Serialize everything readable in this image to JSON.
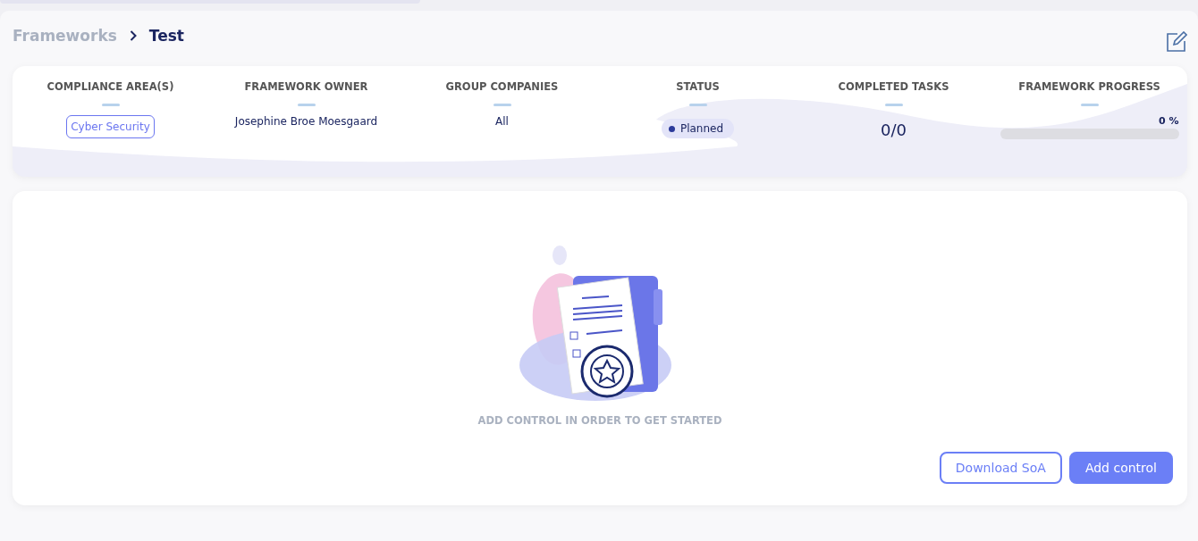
{
  "breadcrumb": [
    {
      "label": "Frameworks",
      "selected": false
    },
    {
      "label": "Test",
      "selected": true
    }
  ],
  "summary": [
    {
      "kind": "tag",
      "heading": "COMPLIANCE AREA(S)",
      "value": "Cyber Security"
    },
    {
      "kind": "text",
      "heading": "FRAMEWORK OWNER",
      "value": "Josephine Broe Moesgaard"
    },
    {
      "kind": "text",
      "heading": "GROUP COMPANIES",
      "value": "All"
    },
    {
      "kind": "status",
      "heading": "STATUS",
      "value": "Planned",
      "color": "#2b3a9a"
    },
    {
      "kind": "count",
      "heading": "COMPLETED TASKS",
      "value": "0/0"
    },
    {
      "kind": "progress",
      "heading": "FRAMEWORK PROGRESS",
      "value": "0 %",
      "level": 0
    }
  ],
  "empty_state": {
    "message": "ADD CONTROL IN ORDER TO GET STARTED"
  },
  "buttons": [
    {
      "label": "Download SoA",
      "kind": "secondary"
    },
    {
      "label": "Add control",
      "kind": "primary"
    }
  ]
}
